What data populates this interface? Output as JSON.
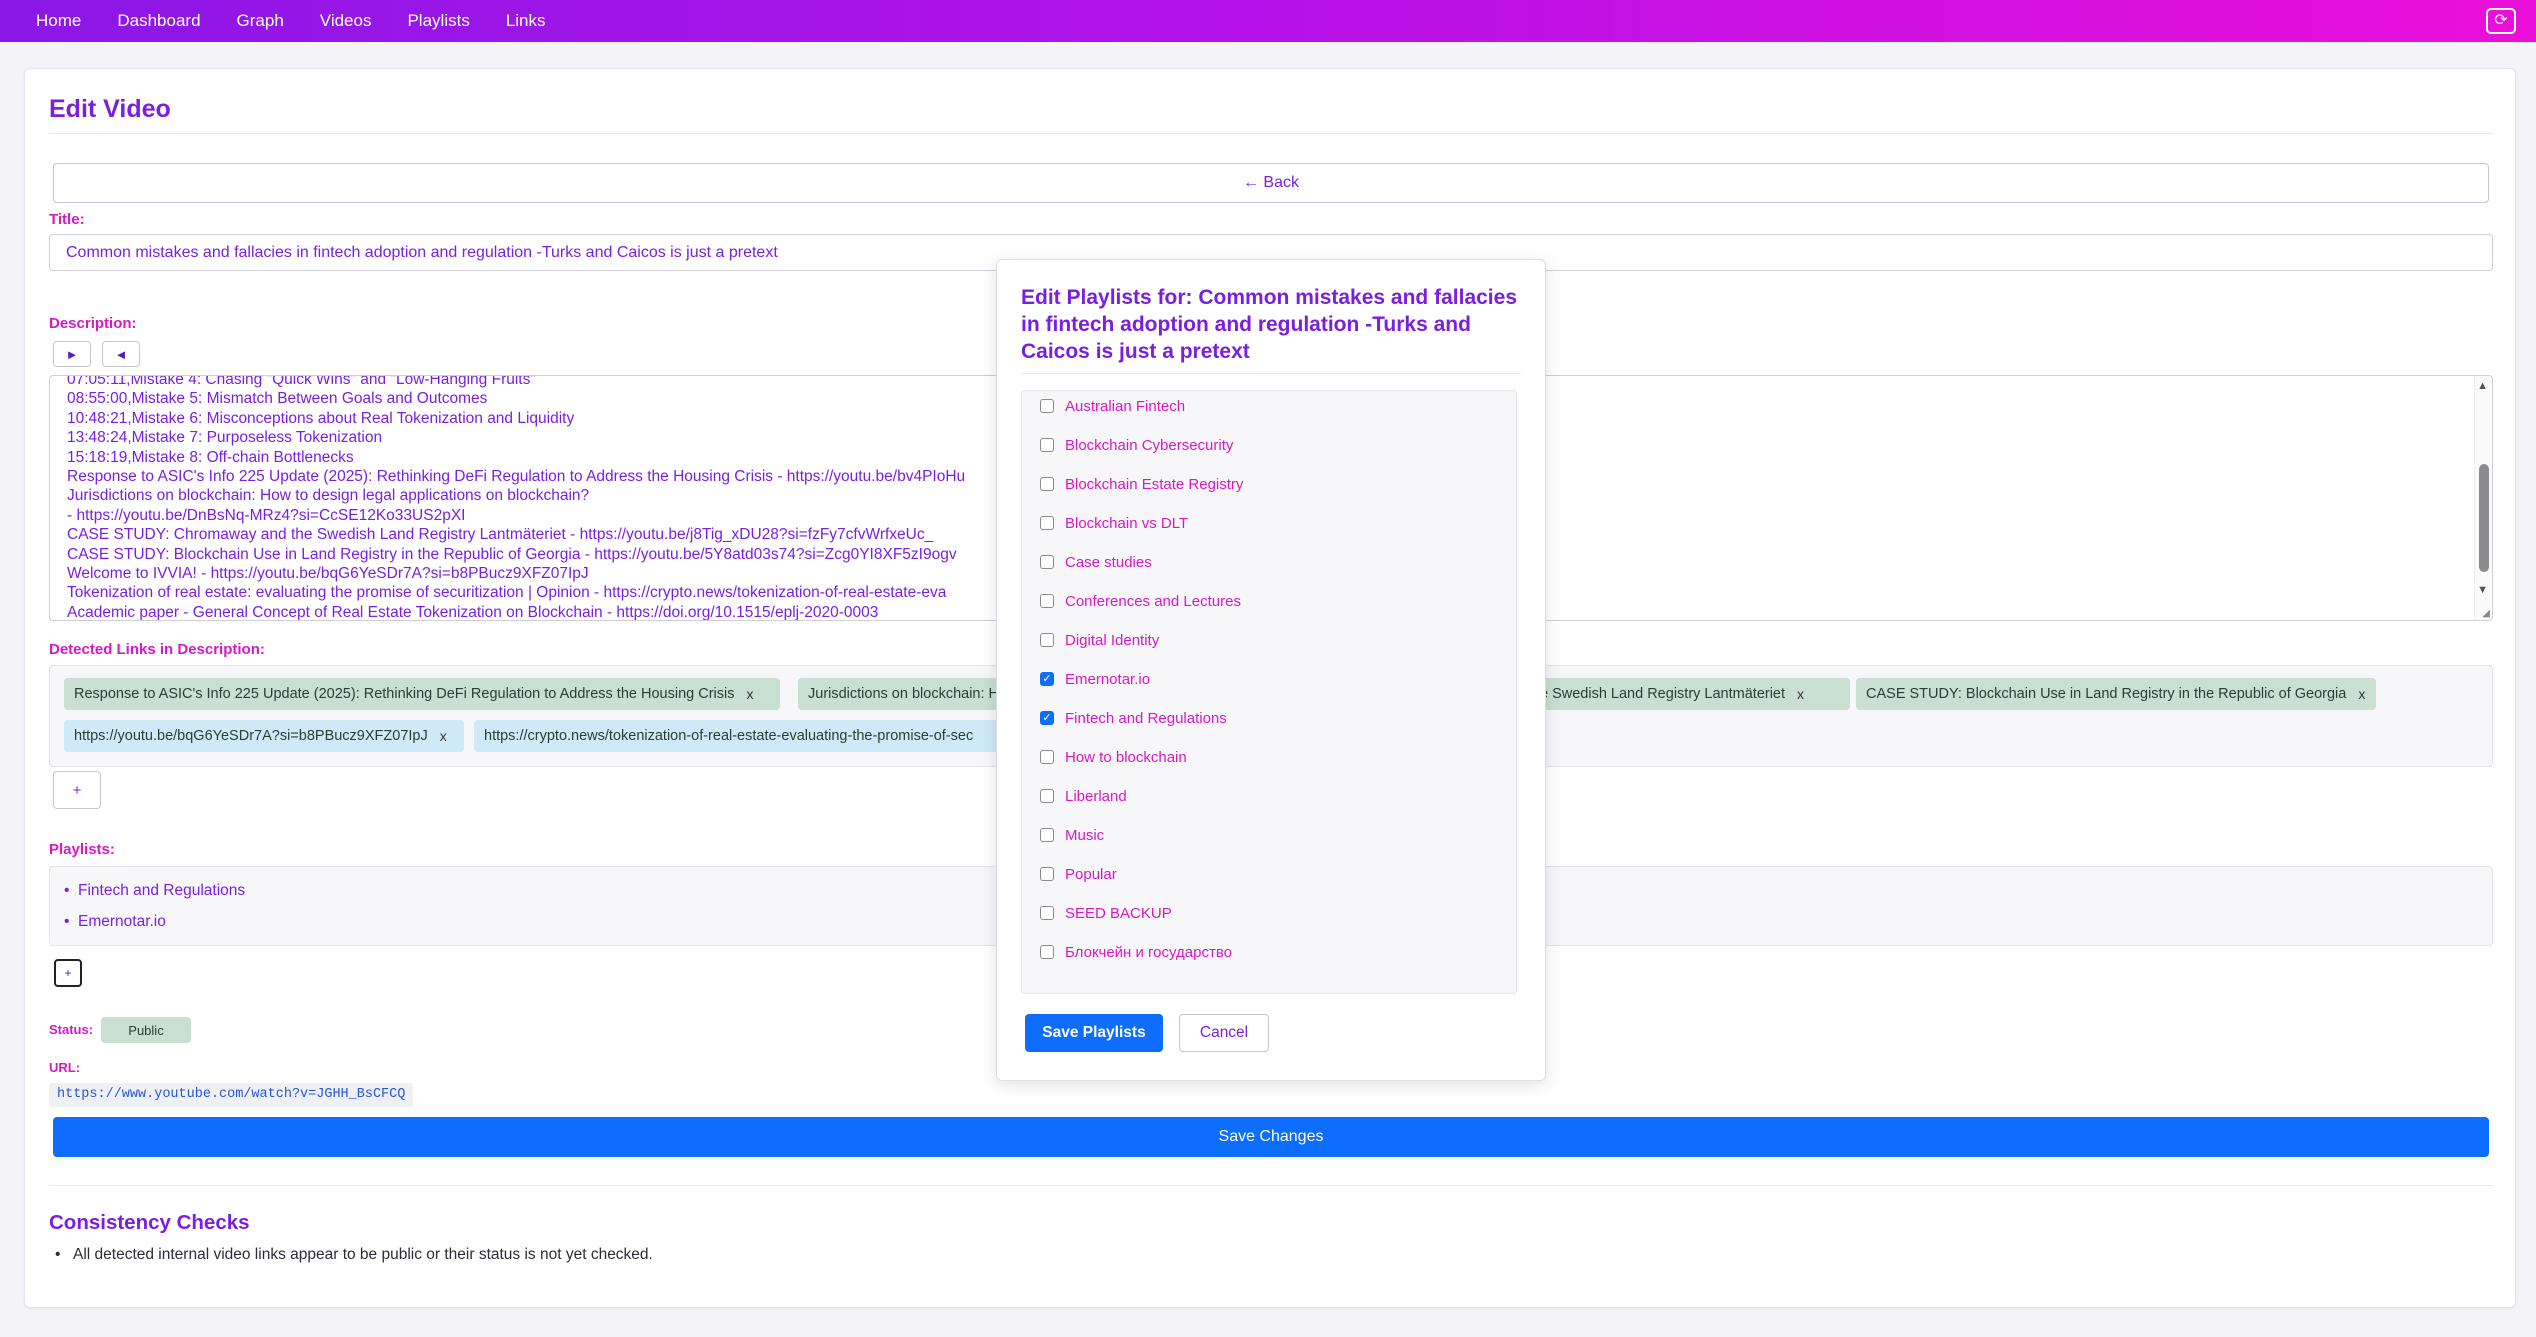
{
  "nav": {
    "items": [
      "Home",
      "Dashboard",
      "Graph",
      "Videos",
      "Playlists",
      "Links"
    ],
    "right_icon": "refresh-icon"
  },
  "page": {
    "title": "Edit Video",
    "back_label": "← Back",
    "title_label": "Title:",
    "title_value": "Common mistakes and fallacies in fintech adoption and regulation -Turks and Caicos is just a pretext",
    "description_label": "Description:",
    "play_label": "►",
    "reverse_label": "◄",
    "description_lines": [
      "07:05:11,Mistake 4: Chasing \"Quick Wins\" and \"Low-Hanging Fruits\"",
      "08:55:00,Mistake 5: Mismatch Between Goals and Outcomes",
      "10:48:21,Mistake 6: Misconceptions about Real Tokenization and Liquidity",
      "13:48:24,Mistake 7: Purposeless Tokenization",
      "15:18:19,Mistake 8: Off-chain Bottlenecks",
      "Response to ASIC's Info 225 Update (2025): Rethinking DeFi Regulation to Address the Housing Crisis - https://youtu.be/bv4PIoHu",
      "Jurisdictions on blockchain: How to design legal applications on blockchain?",
      "- https://youtu.be/DnBsNq-MRz4?si=CcSE12Ko33US2pXI",
      "CASE STUDY: Chromaway and the Swedish Land Registry Lantmäteriet - https://youtu.be/j8Tig_xDU28?si=fzFy7cfvWrfxeUc_",
      "CASE STUDY: Blockchain Use in Land Registry in the Republic of Georgia - https://youtu.be/5Y8atd03s74?si=Zcg0YI8XF5zI9ogv",
      "Welcome to IVVIA! - https://youtu.be/bqG6YeSDr7A?si=b8PBucz9XFZ07IpJ",
      "Tokenization of real estate: evaluating the promise of securitization | Opinion - https://crypto.news/tokenization-of-real-estate-eva",
      "Academic paper - General Concept of Real Estate Tokenization on Blockchain - https://doi.org/10.1515/eplj-2020-0003"
    ],
    "links_label": "Detected Links in Description:",
    "link_chips_row1": [
      "Response to ASIC's Info 225 Update (2025): Rethinking DeFi Regulation to Address the Housing Crisis",
      "Jurisdictions on blockchain: How",
      "e Swedish Land Registry Lantmäteriet",
      "CASE STUDY: Blockchain Use in Land Registry in the Republic of Georgia"
    ],
    "link_chips_row2": [
      "https://youtu.be/bqG6YeSDr7A?si=b8PBucz9XFZ07IpJ",
      "https://crypto.news/tokenization-of-real-estate-evaluating-the-promise-of-sec"
    ],
    "chip_remove": "x",
    "add_label": "+",
    "playlists_label": "Playlists:",
    "playlists": [
      "Fintech and Regulations",
      "Emernotar.io"
    ],
    "status_label": "Status:",
    "status_value": "Public",
    "url_label": "URL:",
    "url_value": "https://www.youtube.com/watch?v=JGHH_BsCFCQ",
    "save_label": "Save Changes",
    "consistency_title": "Consistency Checks",
    "consistency_items": [
      "All detected internal video links appear to be public or their status is not yet checked."
    ]
  },
  "modal": {
    "title": "Edit Playlists for: Common mistakes and fallacies in fintech adoption and regulation -Turks and Caicos is just a pretext",
    "options": [
      {
        "label": "Australian Fintech",
        "checked": false
      },
      {
        "label": "Blockchain Cybersecurity",
        "checked": false
      },
      {
        "label": "Blockchain Estate Registry",
        "checked": false
      },
      {
        "label": "Blockchain vs DLT",
        "checked": false
      },
      {
        "label": "Case studies",
        "checked": false
      },
      {
        "label": "Conferences and Lectures",
        "checked": false
      },
      {
        "label": "Digital Identity",
        "checked": false
      },
      {
        "label": "Emernotar.io",
        "checked": true
      },
      {
        "label": "Fintech and Regulations",
        "checked": true
      },
      {
        "label": "How to blockchain",
        "checked": false
      },
      {
        "label": "Liberland",
        "checked": false
      },
      {
        "label": "Music",
        "checked": false
      },
      {
        "label": "Popular",
        "checked": false
      },
      {
        "label": "SEED BACKUP",
        "checked": false
      },
      {
        "label": "Блокчейн и государство",
        "checked": false
      }
    ],
    "save_label": "Save Playlists",
    "cancel_label": "Cancel"
  },
  "colors": {
    "nav_gradient_start": "#8a17e6",
    "nav_gradient_end": "#ea0fd8",
    "primary": "#0d6efd",
    "accent_text": "#7a1fe0",
    "label_pink": "#d619c7"
  }
}
